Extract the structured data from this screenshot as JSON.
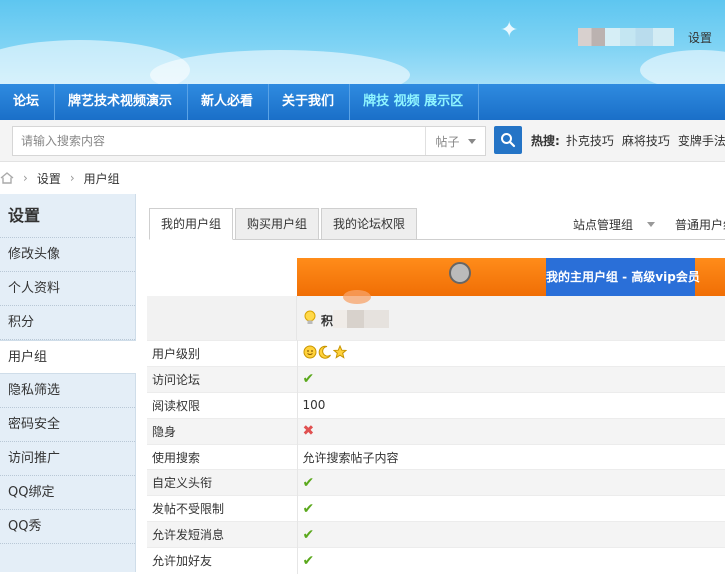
{
  "header": {
    "settings_link": "设置"
  },
  "nav": {
    "items": [
      "论坛",
      "牌艺技术视频演示",
      "新人必看",
      "关于我们",
      "牌技 视频 展示区"
    ]
  },
  "search": {
    "placeholder": "请输入搜索内容",
    "type": "帖子",
    "hot_label": "热搜:",
    "hot_links": [
      "扑克技巧",
      "麻将技巧",
      "变牌手法"
    ]
  },
  "breadcrumb": {
    "items": [
      "设置",
      "用户组"
    ]
  },
  "sidebar": {
    "title": "设置",
    "items": [
      "修改头像",
      "个人资料",
      "积分",
      "用户组",
      "隐私筛选",
      "密码安全",
      "访问推广",
      "QQ绑定",
      "QQ秀"
    ],
    "active_index": 3
  },
  "main": {
    "tabs": [
      "我的用户组",
      "购买用户组",
      "我的论坛权限"
    ],
    "group_selects": [
      "站点管理组",
      "普通用户组"
    ],
    "main_group_label": "我的主用户组 - 高级vip会员",
    "group_name_prefix": "积",
    "rows": [
      {
        "label": "用户级别",
        "type": "icons"
      },
      {
        "label": "访问论坛",
        "type": "check"
      },
      {
        "label": "阅读权限",
        "type": "text",
        "value": "100"
      },
      {
        "label": "隐身",
        "type": "cross"
      },
      {
        "label": "使用搜索",
        "type": "text",
        "value": "允许搜索帖子内容"
      },
      {
        "label": "自定义头衔",
        "type": "check"
      },
      {
        "label": "发帖不受限制",
        "type": "check"
      },
      {
        "label": "允许发短消息",
        "type": "check"
      },
      {
        "label": "允许加好友",
        "type": "check"
      }
    ]
  },
  "colors": {
    "nav_bg": "#1a6fc8",
    "accent_orange": "#f06e05",
    "main_group_blue": "#2a6fd8",
    "check_green": "#5aa81c",
    "cross_red": "#e05050"
  }
}
